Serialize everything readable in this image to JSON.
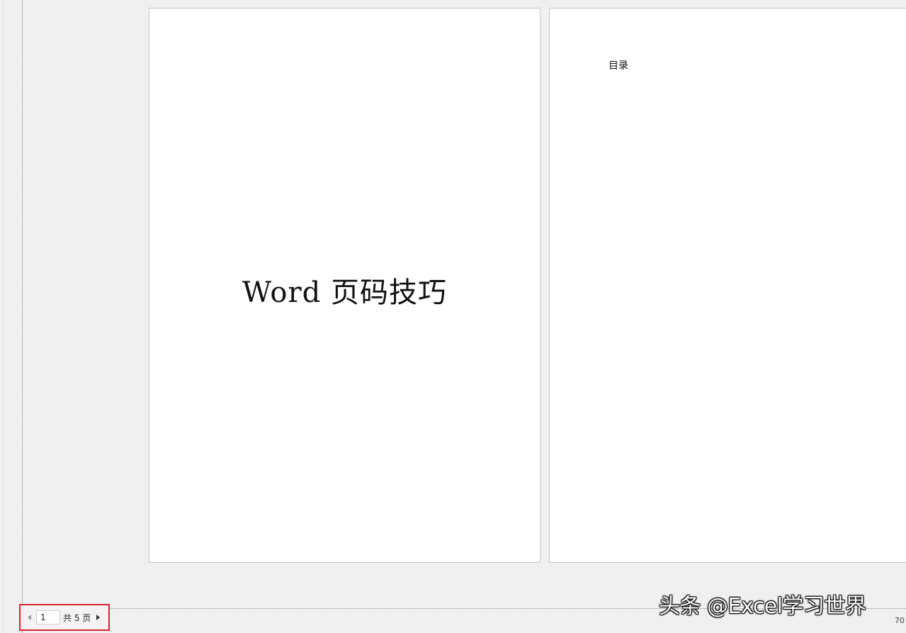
{
  "pages": [
    {
      "title": "Word 页码技巧"
    },
    {
      "heading": "目录"
    }
  ],
  "page_nav": {
    "current_page": "1",
    "total_label": "共 5 页",
    "prev_icon": "triangle-left-icon",
    "next_icon": "triangle-right-icon"
  },
  "zoom": {
    "label": "70"
  },
  "watermark": {
    "text": "头条 @Excel学习世界"
  },
  "colors": {
    "highlight_border": "#d9232e",
    "page_background": "#ffffff",
    "workspace_background": "#f0f0f0"
  }
}
